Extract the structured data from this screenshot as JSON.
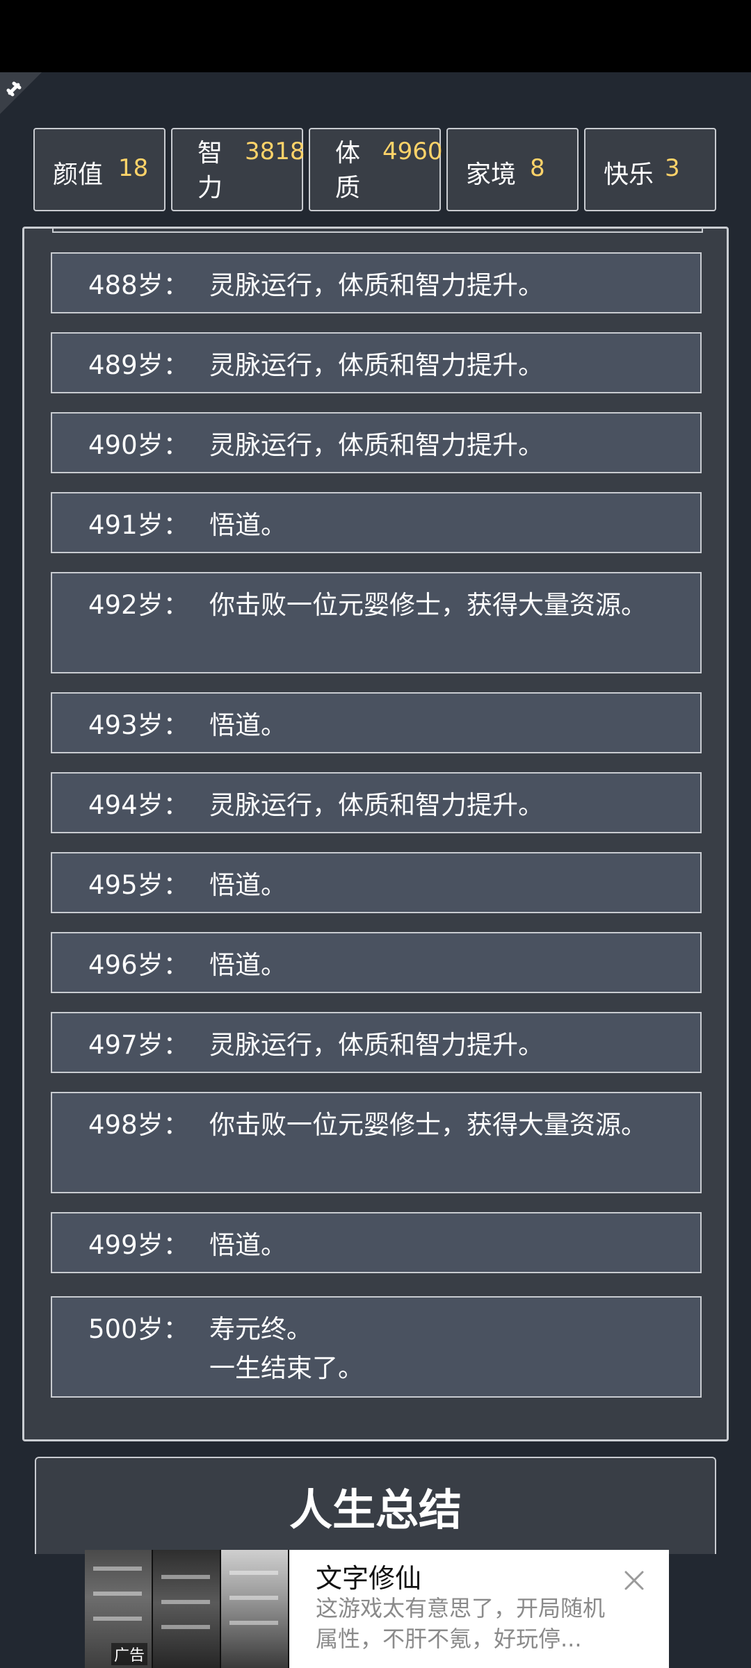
{
  "stats": [
    {
      "label": "颜值",
      "value": "18"
    },
    {
      "label": "智力",
      "value": "3818"
    },
    {
      "label": "体质",
      "value": "4960"
    },
    {
      "label": "家境",
      "value": "8"
    },
    {
      "label": "快乐",
      "value": "3"
    }
  ],
  "log": [
    {
      "age": "488岁：",
      "text": "灵脉运行，体质和智力提升。"
    },
    {
      "age": "489岁：",
      "text": "灵脉运行，体质和智力提升。"
    },
    {
      "age": "490岁：",
      "text": "灵脉运行，体质和智力提升。"
    },
    {
      "age": "491岁：",
      "text": "悟道。"
    },
    {
      "age": "492岁：",
      "text": "你击败一位元婴修士，获得大量资源。"
    },
    {
      "age": "493岁：",
      "text": "悟道。"
    },
    {
      "age": "494岁：",
      "text": "灵脉运行，体质和智力提升。"
    },
    {
      "age": "495岁：",
      "text": "悟道。"
    },
    {
      "age": "496岁：",
      "text": "悟道。"
    },
    {
      "age": "497岁：",
      "text": "灵脉运行，体质和智力提升。"
    },
    {
      "age": "498岁：",
      "text": "你击败一位元婴修士，获得大量资源。"
    },
    {
      "age": "499岁：",
      "text": "悟道。"
    },
    {
      "age": "500岁：",
      "text": "寿元终。\n一生结束了。"
    }
  ],
  "summary_button": "人生总结",
  "ad": {
    "tag": "广告",
    "title": "文字修仙",
    "description": "这游戏太有意思了，开局随机属性，不肝不氪，好玩停..."
  },
  "colors": {
    "background": "#222831",
    "panel": "#393e46",
    "entry": "#4a5260",
    "value_accent": "#ffd369",
    "border": "#c9ccd1"
  }
}
